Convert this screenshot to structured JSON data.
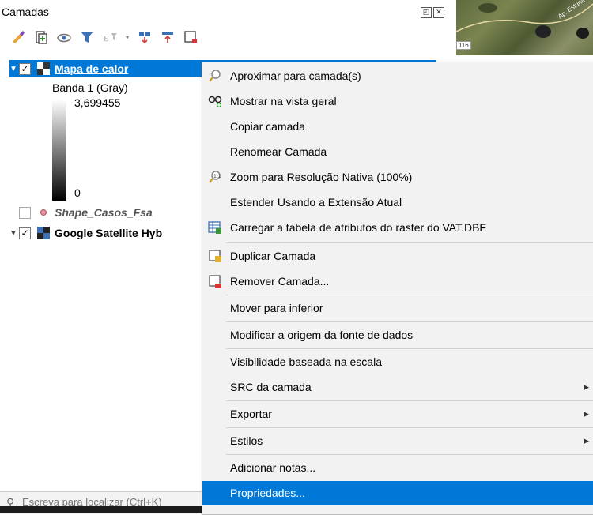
{
  "panel": {
    "title": "Camadas",
    "float_button": "◰",
    "close_button": "✕"
  },
  "toolbar": {
    "icons": [
      "brush-icon",
      "add-group-icon",
      "eye-icon",
      "filter-icon",
      "expression-filter-icon",
      "expand-all-icon",
      "collapse-all-icon",
      "remove-layer-icon"
    ]
  },
  "map": {
    "road_label": "116",
    "place_label": "Ap. Estuna"
  },
  "layers": [
    {
      "name": "Mapa de calor",
      "checked": true,
      "selected": true
    },
    {
      "name": "Shape_Casos_Fsa",
      "checked": false,
      "selected": false
    },
    {
      "name": "Google Satellite Hyb",
      "checked": true,
      "selected": false
    }
  ],
  "legend": {
    "band": "Banda 1 (Gray)",
    "max": "3,699455",
    "min": "0"
  },
  "search": {
    "placeholder": "Escreva para localizar (Ctrl+K)"
  },
  "menu": {
    "items": [
      {
        "label": "Aproximar para camada(s)",
        "icon": "zoom-to-layer-icon"
      },
      {
        "label": "Mostrar na vista geral",
        "icon": "overview-icon"
      },
      {
        "label": "Copiar camada",
        "icon": ""
      },
      {
        "label": "Renomear Camada",
        "icon": ""
      },
      {
        "label": "Zoom para Resolução Nativa (100%)",
        "icon": "zoom-native-icon"
      },
      {
        "label": "Estender Usando a Extensão Atual",
        "icon": ""
      },
      {
        "label": "Carregar a tabela de atributos do raster do VAT.DBF",
        "icon": "raster-table-icon"
      },
      {
        "label": "Duplicar Camada",
        "icon": "duplicate-layer-icon"
      },
      {
        "label": "Remover Camada...",
        "icon": "remove-layer-icon"
      },
      {
        "label": "Mover para  inferior",
        "icon": ""
      },
      {
        "label": "Modificar a origem da fonte de dados",
        "icon": ""
      },
      {
        "label": "Visibilidade baseada na escala",
        "icon": ""
      },
      {
        "label": "SRC da camada",
        "icon": "",
        "submenu": true
      },
      {
        "label": "Exportar",
        "icon": "",
        "submenu": true
      },
      {
        "label": "Estilos",
        "icon": "",
        "submenu": true
      },
      {
        "label": "Adicionar notas...",
        "icon": ""
      },
      {
        "label": "Propriedades...",
        "icon": "",
        "selected": true
      }
    ],
    "submenu_arrow": "▶",
    "accent": "#0078d7"
  }
}
